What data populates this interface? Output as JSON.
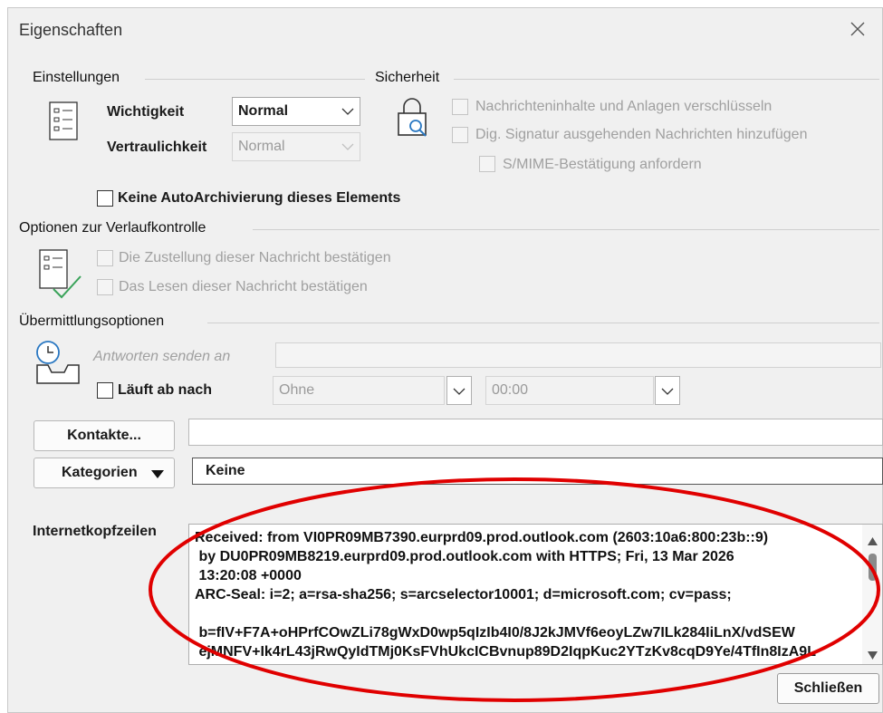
{
  "dialog": {
    "title": "Eigenschaften"
  },
  "einstellungen": {
    "heading": "Einstellungen",
    "importance_label": "Wichtigkeit",
    "importance_value": "Normal",
    "sensitivity_label": "Vertraulichkeit",
    "sensitivity_value": "Normal",
    "no_autoarchive_label": "Keine AutoArchivierung dieses Elements"
  },
  "sicherheit": {
    "heading": "Sicherheit",
    "encrypt_label": "Nachrichteninhalte und Anlagen verschlüsseln",
    "sign_label": "Dig. Signatur ausgehenden Nachrichten hinzufügen",
    "smime_label": "S/MIME-Bestätigung anfordern"
  },
  "verlauf": {
    "heading": "Optionen zur Verlaufkontrolle",
    "delivery_label": "Die Zustellung dieser Nachricht bestätigen",
    "read_label": "Das Lesen dieser Nachricht bestätigen"
  },
  "uebermittlung": {
    "heading": "Übermittlungsoptionen",
    "reply_to_label": "Antworten senden an",
    "expires_label": "Läuft ab nach",
    "expires_date": "Ohne",
    "expires_time": "00:00"
  },
  "contacts_button": "Kontakte...",
  "categories": {
    "button_pre": "Kate",
    "button_accel": "g",
    "button_post": "orien",
    "value": "Keine"
  },
  "internet_headers": {
    "label": "Internetkopfzeilen",
    "text": "Received: from VI0PR09MB7390.eurprd09.prod.outlook.com (2603:10a6:800:23b::9)\n by DU0PR09MB8219.eurprd09.prod.outlook.com with HTTPS; Fri, 13 Mar 2026\n 13:20:08 +0000\nARC-Seal: i=2; a=rsa-sha256; s=arcselector10001; d=microsoft.com; cv=pass;\n\n b=fIV+F7A+oHPrfCOwZLi78gWxD0wp5qIzIb4I0/8J2kJMVf6eoyLZw7ILk284IiLnX/vdSEW\n ejMNFV+Ik4rL43jRwQyIdTMj0KsFVhUkcICBvnup89D2IqpKuc2YTzKv8cqD9Ye/4TfIn8IzA9L"
  },
  "close_button": "Schließen",
  "colors": {
    "annotation_circle": "#e00000",
    "dialog_bg": "#f0f0f0",
    "check_green": "#3aa35a"
  }
}
